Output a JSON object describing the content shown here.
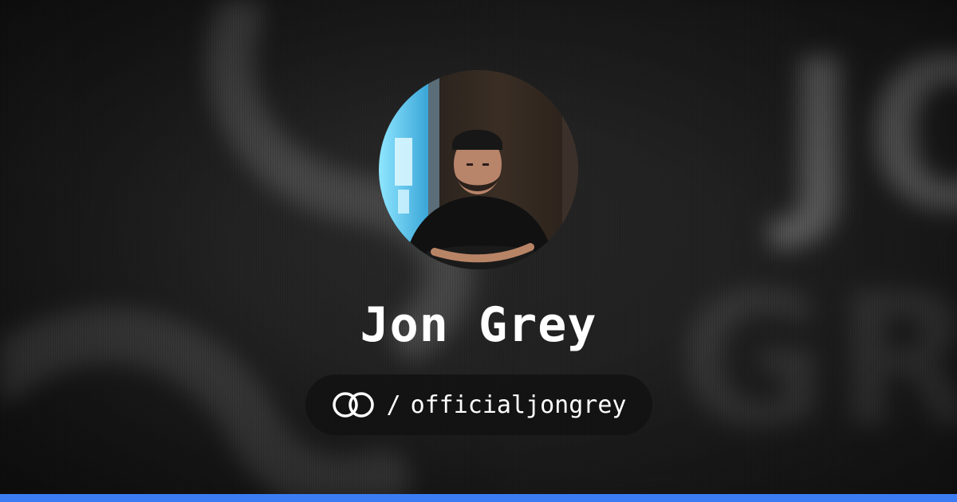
{
  "profile": {
    "name": "Jon Grey",
    "separator": "/",
    "handle": "officialjongrey",
    "platform_icon": "linked-rings-icon",
    "avatar_alt": "avatar"
  },
  "background": {
    "blurred_text_top": "JO",
    "blurred_text_bottom": "GRE"
  },
  "colors": {
    "accent_bar": "#3b7cf4",
    "name_text": "#ffffff",
    "pill_background": "#121212"
  }
}
